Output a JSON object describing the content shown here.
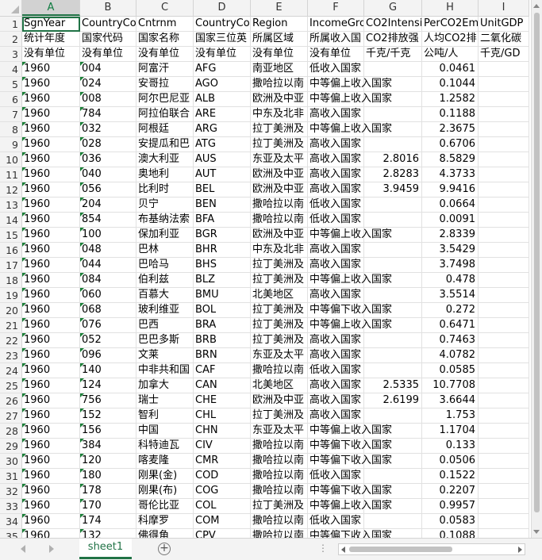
{
  "columns": [
    "A",
    "B",
    "C",
    "D",
    "E",
    "F",
    "G",
    "H",
    "I"
  ],
  "active_column": "A",
  "selected_cell": "A1",
  "rows": [
    {
      "n": "1",
      "cells": [
        "SgnYear",
        "CountryCo",
        "Cntrnm",
        "CountryCo",
        "Region",
        "IncomeGro",
        "CO2Intensi",
        "PerCO2Em",
        "UnitGDP"
      ]
    },
    {
      "n": "2",
      "cells": [
        "统计年度",
        "国家代码",
        "国家名称",
        "国家三位英",
        "所属区域",
        "所属收入国",
        "CO2排放强",
        "人均CO2排",
        "二氧化碳"
      ]
    },
    {
      "n": "3",
      "cells": [
        "没有单位",
        "没有单位",
        "没有单位",
        "没有单位",
        "没有单位",
        "没有单位",
        "千克/千克",
        "公吨/人",
        "千克/GD"
      ]
    },
    {
      "n": "4",
      "cells": [
        "1960",
        "004",
        "阿富汗",
        "AFG",
        "南亚地区",
        "低收入国家",
        "",
        "0.0461",
        ""
      ]
    },
    {
      "n": "5",
      "cells": [
        "1960",
        "024",
        "安哥拉",
        "AGO",
        "撒哈拉以南",
        "中等偏上收入国家",
        "",
        "0.1044",
        ""
      ]
    },
    {
      "n": "6",
      "cells": [
        "1960",
        "008",
        "阿尔巴尼亚",
        "ALB",
        "欧洲及中亚",
        "中等偏上收入国家",
        "",
        "1.2582",
        ""
      ]
    },
    {
      "n": "7",
      "cells": [
        "1960",
        "784",
        "阿拉伯联合",
        "ARE",
        "中东及北非",
        "高收入国家",
        "",
        "0.1188",
        ""
      ]
    },
    {
      "n": "8",
      "cells": [
        "1960",
        "032",
        "阿根廷",
        "ARG",
        "拉丁美洲及",
        "中等偏上收入国家",
        "",
        "2.3675",
        ""
      ]
    },
    {
      "n": "9",
      "cells": [
        "1960",
        "028",
        "安提瓜和巴",
        "ATG",
        "拉丁美洲及",
        "高收入国家",
        "",
        "0.6706",
        ""
      ]
    },
    {
      "n": "10",
      "cells": [
        "1960",
        "036",
        "澳大利亚",
        "AUS",
        "东亚及太平",
        "高收入国家",
        "2.8016",
        "8.5829",
        ""
      ]
    },
    {
      "n": "11",
      "cells": [
        "1960",
        "040",
        "奥地利",
        "AUT",
        "欧洲及中亚",
        "高收入国家",
        "2.8283",
        "4.3733",
        ""
      ]
    },
    {
      "n": "12",
      "cells": [
        "1960",
        "056",
        "比利时",
        "BEL",
        "欧洲及中亚",
        "高收入国家",
        "3.9459",
        "9.9416",
        ""
      ]
    },
    {
      "n": "13",
      "cells": [
        "1960",
        "204",
        "贝宁",
        "BEN",
        "撒哈拉以南",
        "低收入国家",
        "",
        "0.0664",
        ""
      ]
    },
    {
      "n": "14",
      "cells": [
        "1960",
        "854",
        "布基纳法索",
        "BFA",
        "撒哈拉以南",
        "低收入国家",
        "",
        "0.0091",
        ""
      ]
    },
    {
      "n": "15",
      "cells": [
        "1960",
        "100",
        "保加利亚",
        "BGR",
        "欧洲及中亚",
        "中等偏上收入国家",
        "",
        "2.8339",
        ""
      ]
    },
    {
      "n": "16",
      "cells": [
        "1960",
        "048",
        "巴林",
        "BHR",
        "中东及北非",
        "高收入国家",
        "",
        "3.5429",
        ""
      ]
    },
    {
      "n": "17",
      "cells": [
        "1960",
        "044",
        "巴哈马",
        "BHS",
        "拉丁美洲及",
        "高收入国家",
        "",
        "3.7498",
        ""
      ]
    },
    {
      "n": "18",
      "cells": [
        "1960",
        "084",
        "伯利兹",
        "BLZ",
        "拉丁美洲及",
        "中等偏上收入国家",
        "",
        "0.478",
        ""
      ]
    },
    {
      "n": "19",
      "cells": [
        "1960",
        "060",
        "百慕大",
        "BMU",
        "北美地区",
        "高收入国家",
        "",
        "3.5514",
        ""
      ]
    },
    {
      "n": "20",
      "cells": [
        "1960",
        "068",
        "玻利维亚",
        "BOL",
        "拉丁美洲及",
        "中等偏下收入国家",
        "",
        "0.272",
        ""
      ]
    },
    {
      "n": "21",
      "cells": [
        "1960",
        "076",
        "巴西",
        "BRA",
        "拉丁美洲及",
        "中等偏上收入国家",
        "",
        "0.6471",
        ""
      ]
    },
    {
      "n": "22",
      "cells": [
        "1960",
        "052",
        "巴巴多斯",
        "BRB",
        "拉丁美洲及",
        "高收入国家",
        "",
        "0.7463",
        ""
      ]
    },
    {
      "n": "23",
      "cells": [
        "1960",
        "096",
        "文莱",
        "BRN",
        "东亚及太平",
        "高收入国家",
        "",
        "4.0782",
        ""
      ]
    },
    {
      "n": "24",
      "cells": [
        "1960",
        "140",
        "中非共和国",
        "CAF",
        "撒哈拉以南",
        "低收入国家",
        "",
        "0.0585",
        ""
      ]
    },
    {
      "n": "25",
      "cells": [
        "1960",
        "124",
        "加拿大",
        "CAN",
        "北美地区",
        "高收入国家",
        "2.5335",
        "10.7708",
        ""
      ]
    },
    {
      "n": "26",
      "cells": [
        "1960",
        "756",
        "瑞士",
        "CHE",
        "欧洲及中亚",
        "高收入国家",
        "2.6199",
        "3.6644",
        ""
      ]
    },
    {
      "n": "27",
      "cells": [
        "1960",
        "152",
        "智利",
        "CHL",
        "拉丁美洲及",
        "高收入国家",
        "",
        "1.753",
        ""
      ]
    },
    {
      "n": "28",
      "cells": [
        "1960",
        "156",
        "中国",
        "CHN",
        "东亚及太平",
        "中等偏上收入国家",
        "",
        "1.1704",
        ""
      ]
    },
    {
      "n": "29",
      "cells": [
        "1960",
        "384",
        "科特迪瓦",
        "CIV",
        "撒哈拉以南",
        "中等偏下收入国家",
        "",
        "0.133",
        ""
      ]
    },
    {
      "n": "30",
      "cells": [
        "1960",
        "120",
        "喀麦隆",
        "CMR",
        "撒哈拉以南",
        "中等偏下收入国家",
        "",
        "0.0506",
        ""
      ]
    },
    {
      "n": "31",
      "cells": [
        "1960",
        "180",
        "刚果(金)",
        "COD",
        "撒哈拉以南",
        "低收入国家",
        "",
        "0.1522",
        ""
      ]
    },
    {
      "n": "32",
      "cells": [
        "1960",
        "178",
        "刚果(布)",
        "COG",
        "撒哈拉以南",
        "中等偏下收入国家",
        "",
        "0.2207",
        ""
      ]
    },
    {
      "n": "33",
      "cells": [
        "1960",
        "170",
        "哥伦比亚",
        "COL",
        "拉丁美洲及",
        "中等偏上收入国家",
        "",
        "0.9957",
        ""
      ]
    },
    {
      "n": "34",
      "cells": [
        "1960",
        "174",
        "科摩罗",
        "COM",
        "撒哈拉以南",
        "低收入国家",
        "",
        "0.0583",
        ""
      ]
    },
    {
      "n": "35",
      "cells": [
        "1960",
        "132",
        "佛得角",
        "CPV",
        "撒哈拉以南",
        "中等偏下收入国家",
        "",
        "0.1088",
        ""
      ]
    }
  ],
  "sheet_tab": "sheet1",
  "add_sheet_symbol": "+",
  "tab_dots": "⋮"
}
